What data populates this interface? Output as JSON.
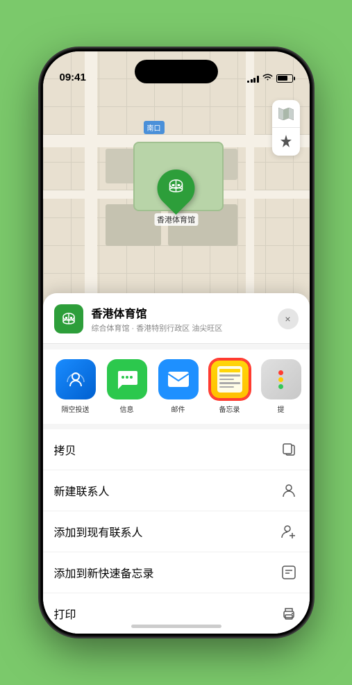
{
  "status_bar": {
    "time": "09:41",
    "signal_bars": [
      3,
      5,
      7,
      9,
      11
    ],
    "wifi": "wifi",
    "battery": 75
  },
  "map": {
    "label": "南口",
    "controls": {
      "map_btn": "🗺",
      "location_btn": "⬆"
    }
  },
  "pin": {
    "label": "香港体育馆",
    "emoji": "🏟"
  },
  "location_card": {
    "name": "香港体育馆",
    "description": "综合体育馆 · 香港特别行政区 油尖旺区",
    "icon_emoji": "🏟",
    "close_label": "×"
  },
  "share_items": [
    {
      "id": "airdrop",
      "label": "隔空投送",
      "type": "airdrop"
    },
    {
      "id": "messages",
      "label": "信息",
      "type": "messages"
    },
    {
      "id": "mail",
      "label": "邮件",
      "type": "mail"
    },
    {
      "id": "notes",
      "label": "备忘录",
      "type": "notes"
    },
    {
      "id": "more",
      "label": "提",
      "type": "more"
    }
  ],
  "actions": [
    {
      "id": "copy",
      "label": "拷贝",
      "icon": "copy"
    },
    {
      "id": "new-contact",
      "label": "新建联系人",
      "icon": "person"
    },
    {
      "id": "add-contact",
      "label": "添加到现有联系人",
      "icon": "person-plus"
    },
    {
      "id": "add-notes",
      "label": "添加到新快速备忘录",
      "icon": "quick-note"
    },
    {
      "id": "print",
      "label": "打印",
      "icon": "print"
    }
  ],
  "more_dots_colors": [
    "#ff3b30",
    "#ffcc00",
    "#34c759"
  ]
}
